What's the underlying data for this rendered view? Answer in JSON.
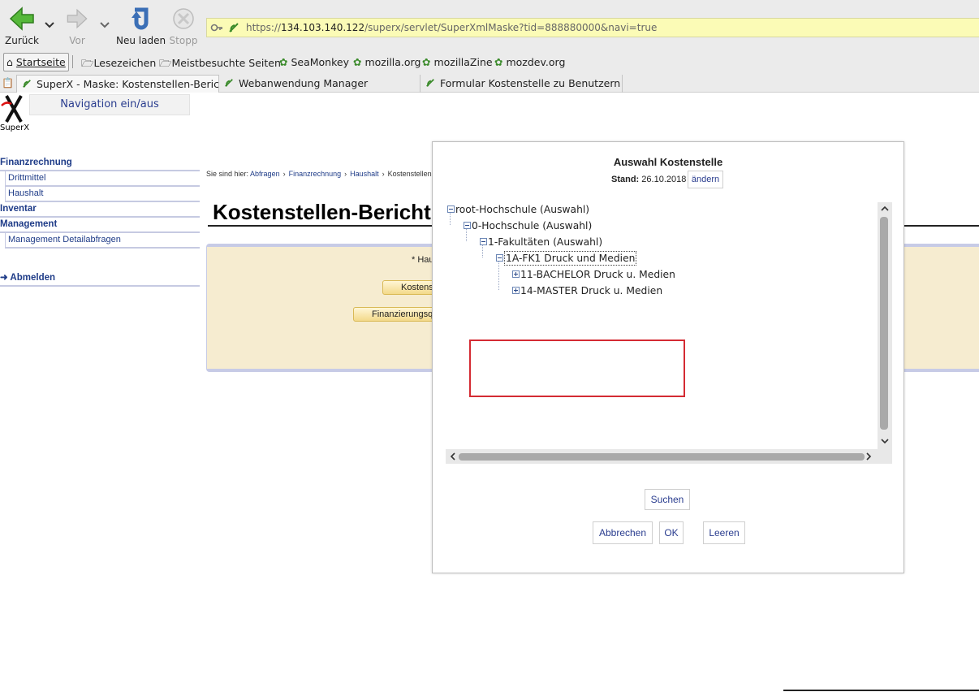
{
  "browser": {
    "back_label": "Zurück",
    "forward_label": "Vor",
    "reload_label": "Neu laden",
    "stop_label": "Stopp",
    "url_prefix": "https://",
    "url_host": "134.103.140.122",
    "url_path": "/superx/servlet/SuperXmlMaske?tid=888880000&navi=true"
  },
  "bookmarks": {
    "items": [
      "Startseite",
      "Lesezeichen",
      "Meistbesuchte Seiten",
      "SeaMonkey",
      "mozilla.org",
      "mozillaZine",
      "mozdev.org"
    ]
  },
  "tabs": [
    {
      "label": "SuperX - Maske: Kostenstellen-Bericht"
    },
    {
      "label": "Webanwendung Manager"
    },
    {
      "label": "Formular Kostenstelle zu Benutzern (L..."
    }
  ],
  "page": {
    "nav_toggle": "Navigation ein/aus",
    "logo_text": "SuperX",
    "sidebar": {
      "sections": [
        {
          "label": "Finanzrechnung",
          "items": [
            "Drittmittel",
            "Haushalt"
          ]
        },
        {
          "label": "Inventar",
          "items": []
        },
        {
          "label": "Management",
          "items": [
            "Management Detailabfragen"
          ]
        }
      ],
      "logout": "Abmelden"
    },
    "breadcrumb": {
      "prefix": "Sie sind hier:",
      "items": [
        "Abfragen",
        "Finanzrechnung",
        "Haushalt",
        "Kostenstellen-Bericht - Bericht erstellen"
      ]
    },
    "title": "Kostenstellen-Bericht",
    "form": {
      "note": "* Hau",
      "btn1": "Kostens",
      "btn2": "Finanzierungsq"
    }
  },
  "dialog": {
    "title": "Auswahl Kostenstelle",
    "stand_label": "Stand:",
    "stand_date": "26.10.2018",
    "change_button": "ändern",
    "tree": [
      {
        "label": "root-Hochschule (Auswahl)",
        "state": "expanded"
      },
      {
        "label": "0-Hochschule (Auswahl)",
        "state": "expanded"
      },
      {
        "label": "1-Fakultäten (Auswahl)",
        "state": "expanded"
      },
      {
        "label": "1A-FK1 Druck und Medien",
        "state": "expanded",
        "selected": true
      },
      {
        "label": "11-BACHELOR Druck u. Medien",
        "state": "collapsed"
      },
      {
        "label": "14-MASTER Druck u. Medien",
        "state": "collapsed"
      }
    ],
    "search_button": "Suchen",
    "cancel_button": "Abbrechen",
    "ok_button": "OK",
    "clear_button": "Leeren"
  },
  "colors": {
    "link": "#1f3c88",
    "form_panel_bg": "#f6ecd0",
    "url_bar_bg": "#fbfbb6",
    "highlight_box": "#d42b33"
  }
}
